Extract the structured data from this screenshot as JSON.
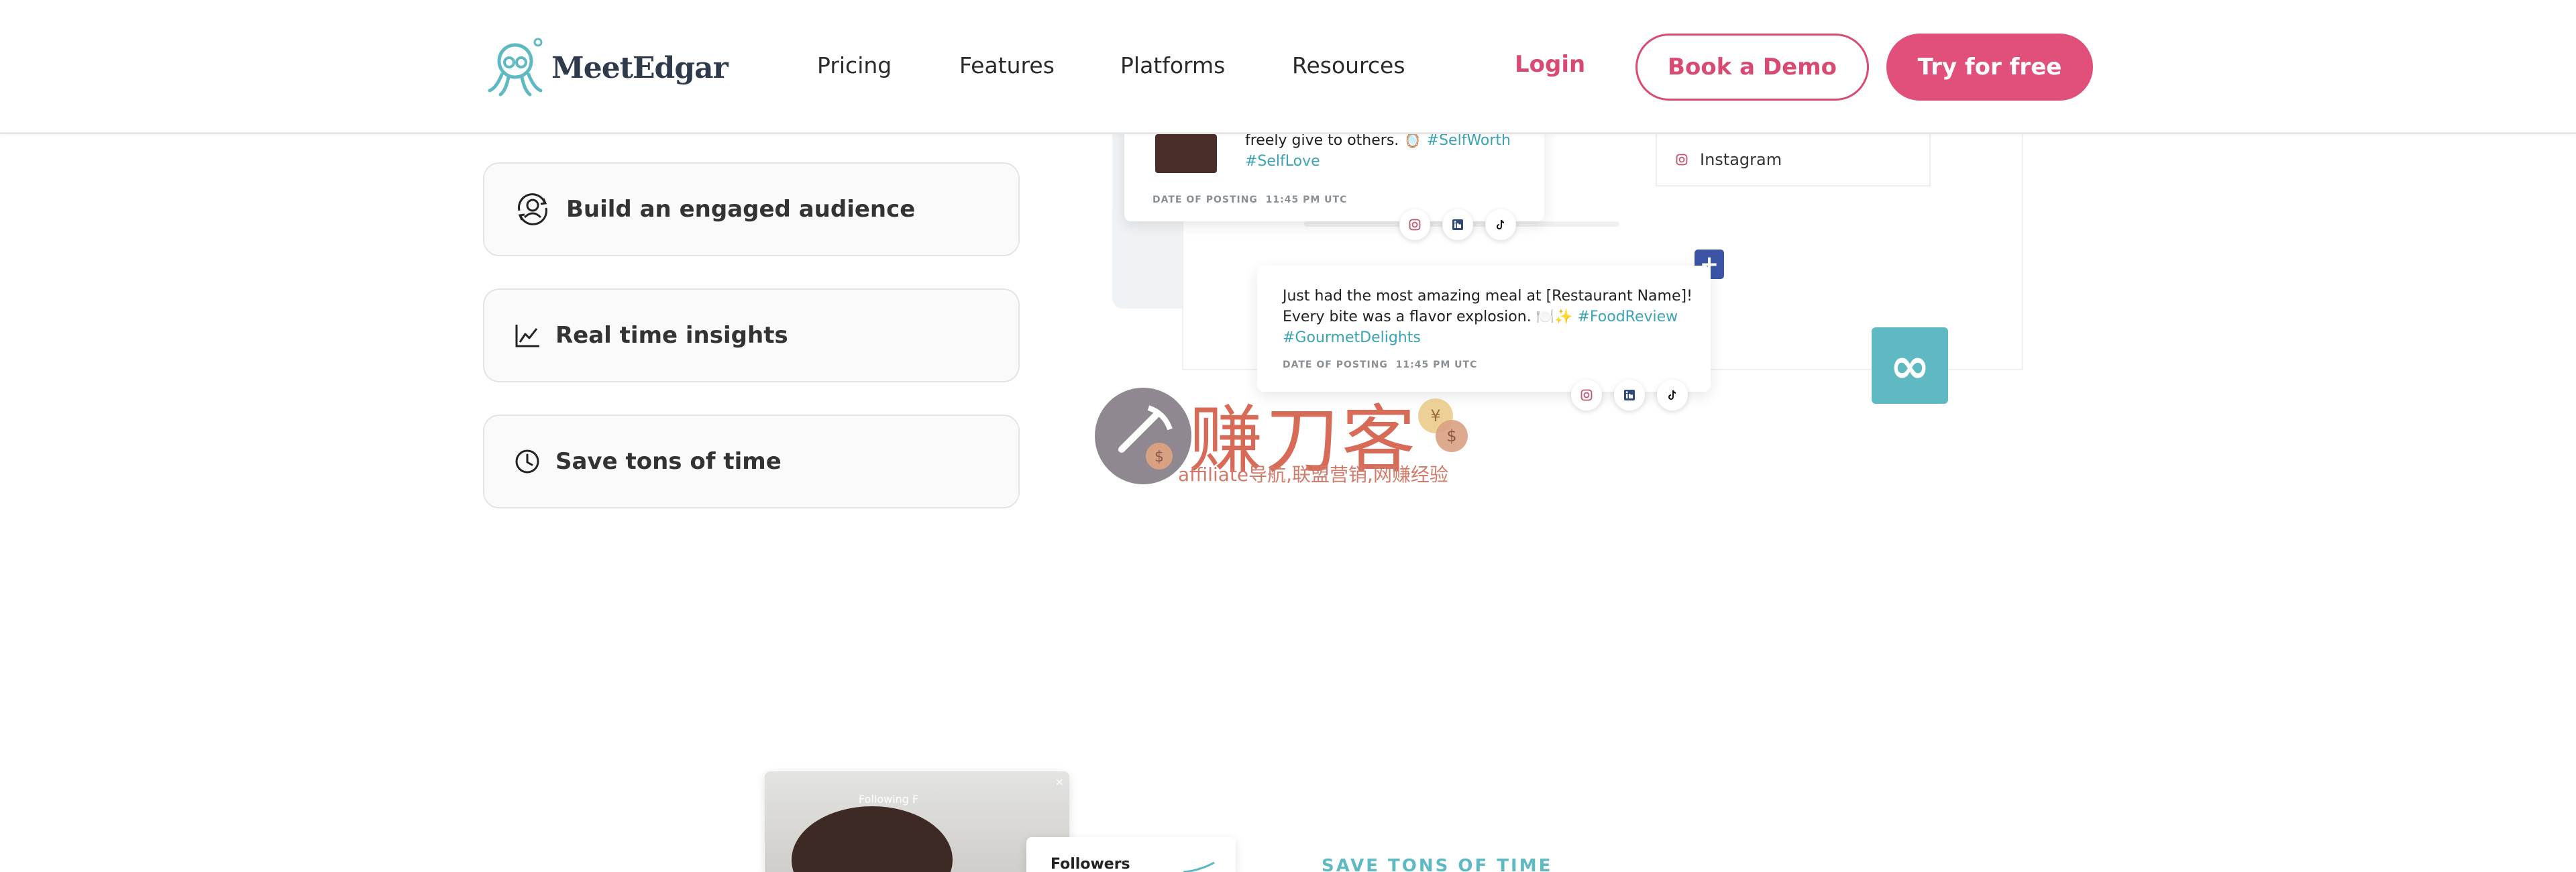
{
  "header": {
    "logo_text": "MeetEdgar",
    "nav": [
      "Pricing",
      "Features",
      "Platforms",
      "Resources"
    ],
    "login": "Login",
    "book_demo": "Book a Demo",
    "try_free": "Try for free"
  },
  "features": [
    {
      "label": "Build an engaged audience",
      "icon": "audience-icon"
    },
    {
      "label": "Real time insights",
      "icon": "chart-line-icon"
    },
    {
      "label": "Save tons of time",
      "icon": "clock-icon"
    }
  ],
  "mockup": {
    "post1": {
      "text_line1": "freely give to others. 🪞",
      "tags": [
        "#SelfWorth",
        "#SelfLove"
      ],
      "date_label": "DATE OF POSTING",
      "date_time": "11:45 PM UTC"
    },
    "platform_row": "Instagram",
    "post2": {
      "line1": "Just had the most amazing meal at [Restaurant Name]!",
      "line2": "Every bite was a flavor explosion. 🍽️✨",
      "tags": [
        "#FoodReview",
        "#GourmetDelights"
      ],
      "date_label": "DATE OF POSTING",
      "date_time": "11:45 PM UTC"
    },
    "plus": "+",
    "infinity": "∞"
  },
  "watermark": {
    "title": "赚刀客",
    "subtitle": "affiliate导航,联盟营销,网赚经验"
  },
  "lower": {
    "photo_tabs": "Following   F",
    "photo_close": "×",
    "followers": "Followers",
    "section_label": "SAVE TONS OF TIME"
  },
  "colors": {
    "brand_pink": "#e0507b",
    "teal": "#5fb9c3",
    "navy": "#3b54a5"
  }
}
